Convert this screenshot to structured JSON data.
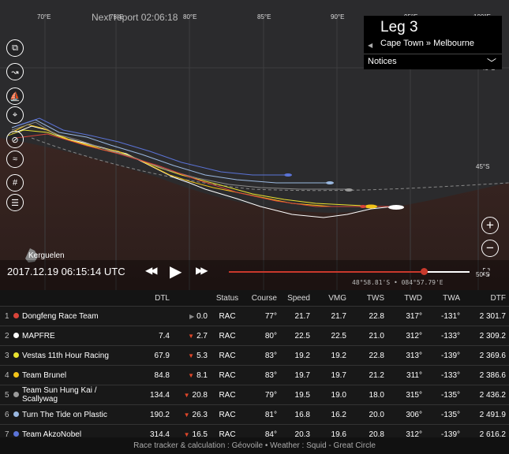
{
  "header": {
    "next_report": "Next report 02:06:18"
  },
  "map": {
    "longitudes": [
      "70°E",
      "75°E",
      "80°E",
      "85°E",
      "90°E",
      "95°E",
      "100°E"
    ],
    "latitudes": [
      "45°S",
      "45°S",
      "50°S"
    ],
    "place_label": "Kerguelen",
    "coordinates_readout": "48°58.81'S • 084°57.79'E"
  },
  "leg_panel": {
    "title": "Leg 3",
    "route": "Cape Town » Melbourne",
    "notices_label": "Notices"
  },
  "tools": [
    {
      "icon": "map-icon",
      "glyph": "⧉"
    },
    {
      "icon": "route-icon",
      "glyph": "↝"
    },
    {
      "icon": "boat-icon",
      "glyph": "⛵"
    },
    {
      "icon": "pin-icon",
      "glyph": "⌖"
    },
    {
      "icon": "compass-icon",
      "glyph": "⊘"
    },
    {
      "icon": "wind-icon",
      "glyph": "≈"
    },
    {
      "icon": "grid-icon",
      "glyph": "#"
    },
    {
      "icon": "layers-icon",
      "glyph": "☰"
    }
  ],
  "playback": {
    "timestamp": "2017.12.19 06:15:14 UTC",
    "rewind": "◀◀",
    "play": "▶",
    "forward": "▶▶",
    "progress": 0.81
  },
  "zoom": {
    "in": "+",
    "out": "−"
  },
  "table": {
    "headers": [
      "DTL",
      "Status",
      "Course",
      "Speed",
      "VMG",
      "TWS",
      "TWD",
      "TWA",
      "DTF"
    ],
    "rows": [
      {
        "rank": "1",
        "color": "#d9443a",
        "team": "Dongfeng Race Team",
        "dtl": "",
        "delta_arrow": "▶",
        "delta": "0.0",
        "status": "RAC",
        "course": "77°",
        "speed": "21.7",
        "vmg": "21.7",
        "tws": "22.8",
        "twd": "317°",
        "twa": "-131°",
        "dtf": "2 301.7"
      },
      {
        "rank": "2",
        "color": "#ffffff",
        "team": "MAPFRE",
        "dtl": "7.4",
        "delta_arrow": "▼",
        "delta": "2.7",
        "status": "RAC",
        "course": "80°",
        "speed": "22.5",
        "vmg": "22.5",
        "tws": "21.0",
        "twd": "312°",
        "twa": "-133°",
        "dtf": "2 309.2"
      },
      {
        "rank": "3",
        "color": "#e8e230",
        "team": "Vestas 11th Hour Racing",
        "dtl": "67.9",
        "delta_arrow": "▼",
        "delta": "5.3",
        "status": "RAC",
        "course": "83°",
        "speed": "19.2",
        "vmg": "19.2",
        "tws": "22.8",
        "twd": "313°",
        "twa": "-139°",
        "dtf": "2 369.6"
      },
      {
        "rank": "4",
        "color": "#f2c318",
        "team": "Team Brunel",
        "dtl": "84.8",
        "delta_arrow": "▼",
        "delta": "8.1",
        "status": "RAC",
        "course": "83°",
        "speed": "19.7",
        "vmg": "19.7",
        "tws": "21.2",
        "twd": "311°",
        "twa": "-133°",
        "dtf": "2 386.6"
      },
      {
        "rank": "5",
        "color": "#9a9a9a",
        "team": "Team Sun Hung Kai / Scallywag",
        "dtl": "134.4",
        "delta_arrow": "▼",
        "delta": "20.8",
        "status": "RAC",
        "course": "79°",
        "speed": "19.5",
        "vmg": "19.0",
        "tws": "18.0",
        "twd": "315°",
        "twa": "-135°",
        "dtf": "2 436.2"
      },
      {
        "rank": "6",
        "color": "#9ab8e0",
        "team": "Turn The Tide on Plastic",
        "dtl": "190.2",
        "delta_arrow": "▼",
        "delta": "26.3",
        "status": "RAC",
        "course": "81°",
        "speed": "16.8",
        "vmg": "16.2",
        "tws": "20.0",
        "twd": "306°",
        "twa": "-135°",
        "dtf": "2 491.9"
      },
      {
        "rank": "7",
        "color": "#5b74d8",
        "team": "Team AkzoNobel",
        "dtl": "314.4",
        "delta_arrow": "▼",
        "delta": "16.5",
        "status": "RAC",
        "course": "84°",
        "speed": "20.3",
        "vmg": "19.6",
        "tws": "20.8",
        "twd": "312°",
        "twa": "-139°",
        "dtf": "2 616.2"
      }
    ]
  },
  "footer": {
    "text": "Race tracker & calculation : Géovoile • Weather : Squid - Great Circle"
  }
}
